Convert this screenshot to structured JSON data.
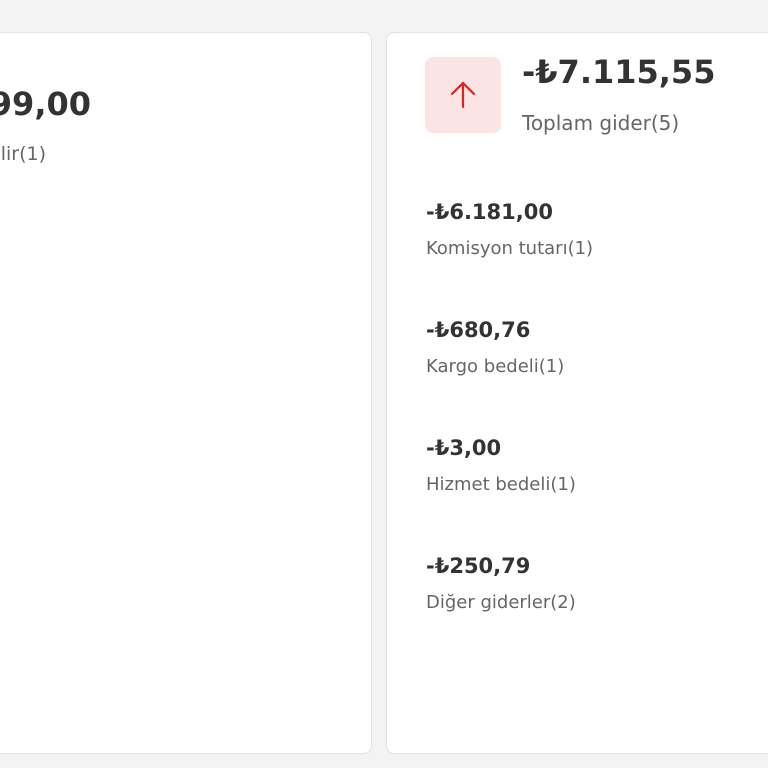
{
  "income_card": {
    "amount_partial": "99,00",
    "label_partial": "lir(1)"
  },
  "expense_card": {
    "icon": "arrow-up-icon",
    "icon_color": "#e02020",
    "icon_bg": "#fde4e4",
    "total_amount": "-₺7.115,55",
    "total_label": "Toplam gider(5)",
    "items": [
      {
        "amount": "-₺6.181,00",
        "label": "Komisyon tutarı(1)"
      },
      {
        "amount": "-₺680,76",
        "label": "Kargo bedeli(1)"
      },
      {
        "amount": "-₺3,00",
        "label": "Hizmet bedeli(1)"
      },
      {
        "amount": "-₺250,79",
        "label": "Diğer giderler(2)"
      }
    ]
  }
}
